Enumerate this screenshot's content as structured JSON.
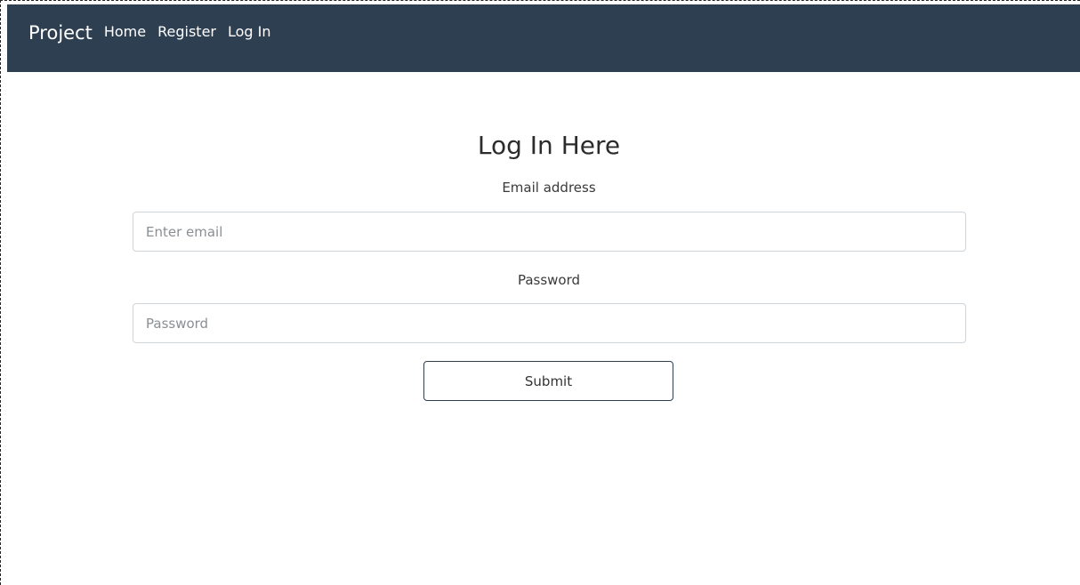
{
  "navbar": {
    "brand": "Project",
    "links": [
      "Home",
      "Register",
      "Log In"
    ],
    "background": "#2e3f52"
  },
  "form": {
    "title": "Log In Here",
    "email_label": "Email address",
    "email_placeholder": "Enter email",
    "email_value": "",
    "password_label": "Password",
    "password_placeholder": "Password",
    "password_value": "",
    "submit_label": "Submit"
  }
}
